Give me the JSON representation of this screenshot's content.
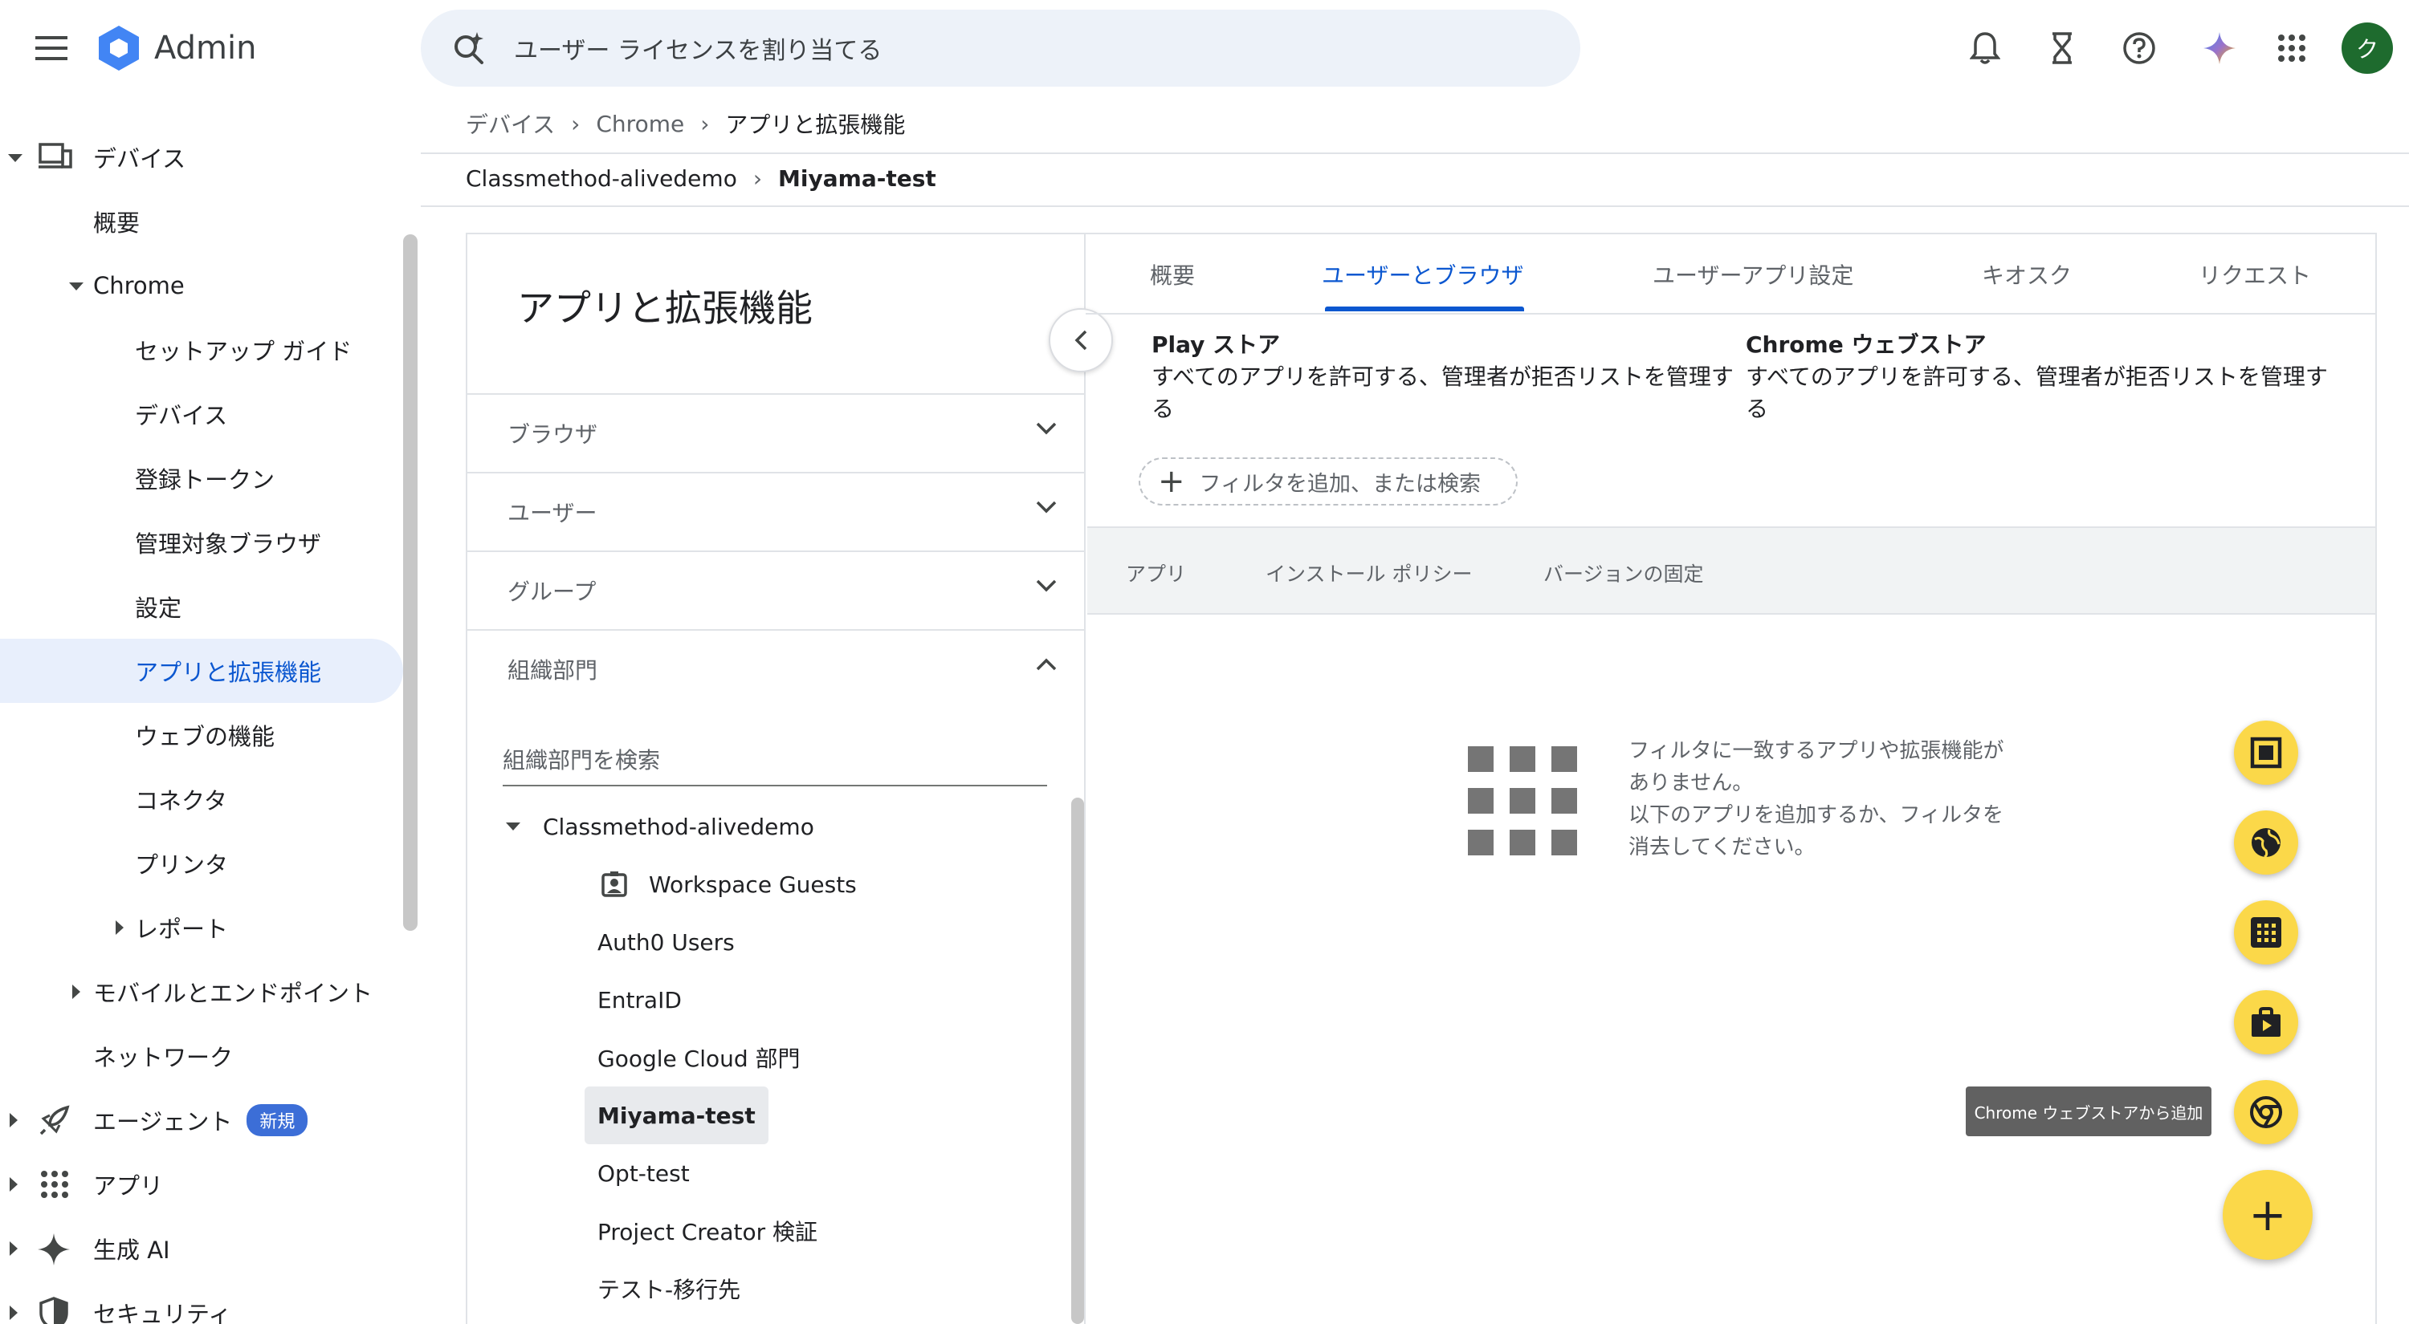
{
  "app": {
    "title": "Admin",
    "avatar_initial": "ク"
  },
  "search": {
    "text": "ユーザー ライセンスを割り当てる"
  },
  "topbar_icons": [
    "bell-icon",
    "hourglass-icon",
    "help-icon",
    "gemini-icon",
    "apps-grid-icon"
  ],
  "sidebar": {
    "items": [
      {
        "label": "デバイス"
      },
      {
        "label": "概要"
      },
      {
        "label": "Chrome"
      },
      {
        "label": "セットアップ ガイド"
      },
      {
        "label": "デバイス"
      },
      {
        "label": "登録トークン"
      },
      {
        "label": "管理対象ブラウザ"
      },
      {
        "label": "設定"
      },
      {
        "label": "アプリと拡張機能"
      },
      {
        "label": "ウェブの機能"
      },
      {
        "label": "コネクタ"
      },
      {
        "label": "プリンタ"
      },
      {
        "label": "レポート"
      },
      {
        "label": "モバイルとエンドポイント"
      },
      {
        "label": "ネットワーク"
      },
      {
        "label": "エージェント"
      },
      {
        "label": "アプリ"
      },
      {
        "label": "生成 AI"
      },
      {
        "label": "セキュリティ"
      }
    ],
    "new_badge": "新規"
  },
  "breadcrumb": {
    "b1": "デバイス",
    "b2": "Chrome",
    "b3": "アプリと拡張機能"
  },
  "ou_breadcrumb": {
    "root": "Classmethod-alivedemo",
    "current": "Miyama-test"
  },
  "panel": {
    "title": "アプリと拡張機能",
    "filters": [
      "ブラウザ",
      "ユーザー",
      "グループ",
      "組織部門"
    ],
    "ou_search_placeholder": "組織部門を検索",
    "tree": {
      "root": "Classmethod-alivedemo",
      "items": [
        "Workspace Guests",
        "Auth0 Users",
        "EntraID",
        "Google Cloud 部門",
        "Miyama-test",
        "Opt-test",
        "Project Creator 検証",
        "テスト-移行先"
      ]
    }
  },
  "tabs": [
    "概要",
    "ユーザーとブラウザ",
    "ユーザーアプリ設定",
    "キオスク",
    "リクエスト"
  ],
  "stores": {
    "play": {
      "title": "Play ストア",
      "desc": "すべてのアプリを許可する、管理者が拒否リストを管理する"
    },
    "webstore": {
      "title": "Chrome ウェブストア",
      "desc": "すべてのアプリを許可する、管理者が拒否リストを管理する"
    }
  },
  "add_filter": "フィルタを追加、または検索",
  "table": {
    "headers": [
      "アプリ",
      "インストール ポリシー",
      "バージョンの固定"
    ]
  },
  "empty": {
    "line1": "フィルタに一致するアプリや拡張機能が",
    "line2": "ありません。",
    "line3": "以下のアプリを追加するか、フィルタを",
    "line4": "消去してください。"
  },
  "tooltip": "Chrome ウェブストアから追加",
  "fab_main": "+",
  "colors": {
    "accent": "#0b57d0",
    "fab": "#fbd849",
    "active_bg": "#e8effc",
    "avatar": "#1e6b2e"
  }
}
